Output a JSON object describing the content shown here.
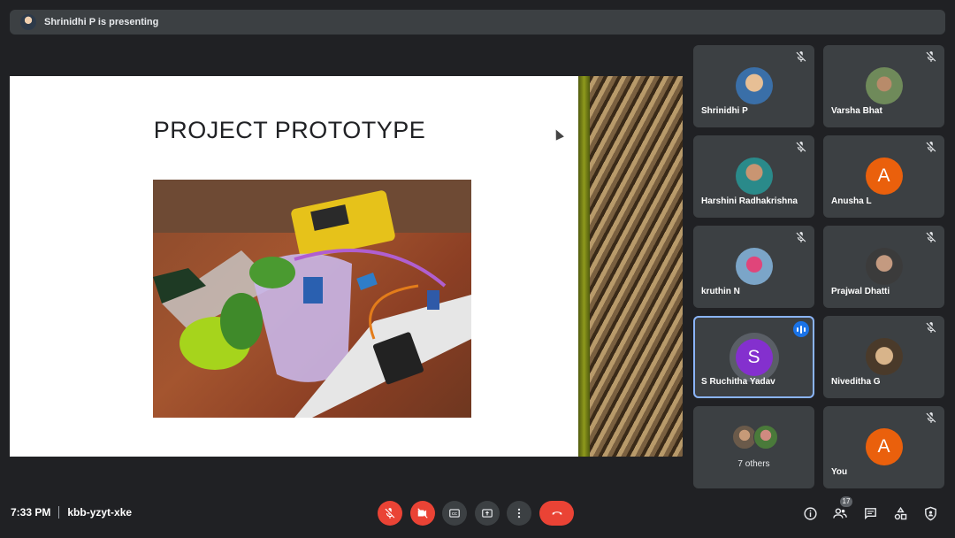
{
  "banner": {
    "text": "Shrinidhi P is presenting"
  },
  "slide": {
    "title": "PROJECT PROTOTYPE"
  },
  "participants": [
    {
      "name": "Shrinidhi P",
      "muted": true
    },
    {
      "name": "Varsha Bhat",
      "muted": true
    },
    {
      "name": "Harshini Radhakrishna",
      "muted": true
    },
    {
      "name": "Anusha L",
      "muted": true,
      "initial": "A"
    },
    {
      "name": "kruthin N",
      "muted": true
    },
    {
      "name": "Prajwal Dhatti",
      "muted": true
    },
    {
      "name": "S Ruchitha Yadav",
      "muted": false,
      "speaking": true,
      "initial": "S"
    },
    {
      "name": "Niveditha G",
      "muted": true
    },
    {
      "name": "7 others"
    },
    {
      "name": "You",
      "muted": true,
      "initial": "A"
    }
  ],
  "meeting": {
    "time": "7:33 PM",
    "code": "kbb-yzyt-xke"
  },
  "people_count": "17",
  "colors": {
    "background": "#202124",
    "tile": "#3c4043",
    "danger": "#ea4335",
    "accent": "#8ab4f8",
    "avatar_orange": "#ea600c",
    "avatar_purple": "#8430ce"
  },
  "icons": [
    "mic-off-icon",
    "camera-off-icon",
    "captions-icon",
    "present-icon",
    "more-options-icon",
    "hang-up-icon",
    "info-icon",
    "people-icon",
    "chat-icon",
    "activities-icon",
    "host-controls-icon",
    "speaking-indicator-icon"
  ]
}
